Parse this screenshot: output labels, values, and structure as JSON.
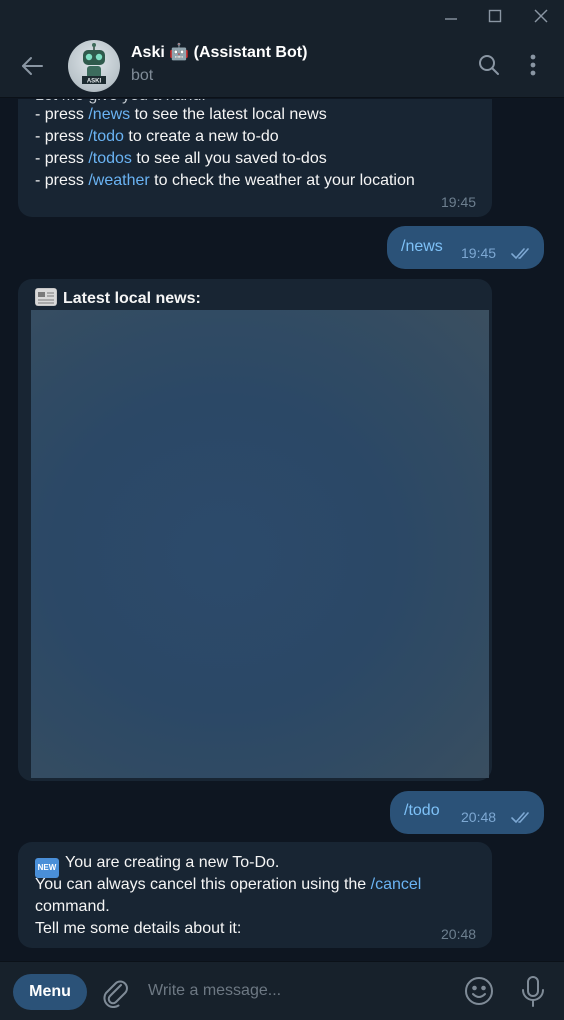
{
  "window": {
    "controls": [
      "minimize-icon",
      "maximize-icon",
      "close-icon"
    ]
  },
  "header": {
    "title": "Aski 🤖 (Assistant Bot)",
    "subtitle": "bot",
    "avatar_text": "ASKI"
  },
  "messages": {
    "help": {
      "partial_top": "Let me give you a hand:",
      "lines": [
        {
          "prefix": "- press ",
          "command": "/news",
          "suffix": " to see the latest local news"
        },
        {
          "prefix": "- press ",
          "command": "/todo",
          "suffix": " to create a new to-do"
        },
        {
          "prefix": "- press ",
          "command": "/todos",
          "suffix": " to see all you saved to-dos"
        },
        {
          "prefix": "- press ",
          "command": "/weather",
          "suffix": " to check the weather at your location"
        }
      ],
      "time": "19:45"
    },
    "out_news": {
      "text": "/news",
      "time": "19:45"
    },
    "news": {
      "title": "Latest local news:"
    },
    "out_todo": {
      "text": "/todo",
      "time": "20:48"
    },
    "todo": {
      "line1": "You are creating a new To-Do.",
      "line2_prefix": "You can always cancel this operation using the ",
      "line2_command": "/cancel",
      "line3": "command.",
      "line4": "Tell me some details about it:",
      "time": "20:48",
      "new_badge": "NEW"
    }
  },
  "composer": {
    "menu_label": "Menu",
    "placeholder": "Write a message..."
  },
  "colors": {
    "background": "#0e1621",
    "panel": "#17212b",
    "incoming_bubble": "#182533",
    "outgoing_bubble": "#2b5278",
    "command_link": "#6ab3f3"
  }
}
